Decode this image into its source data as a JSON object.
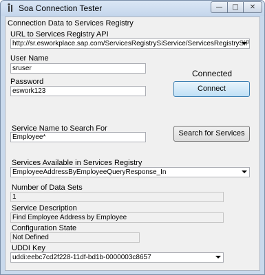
{
  "window": {
    "title": "Soa Connection Tester",
    "controls": {
      "minimize": "—",
      "maximize": "□",
      "close": "✕"
    }
  },
  "connection": {
    "group_label": "Connection Data to Services Registry",
    "url_label": "URL to Services Registry API",
    "url_value": "http://sr.esworkplace.sap.com/ServicesRegistrySiService/ServicesRegistrySiPort",
    "user_label": "User Name",
    "user_value": "sruser",
    "password_label": "Password",
    "password_value": "eswork123",
    "status": "Connected",
    "connect_button": "Connect"
  },
  "search": {
    "label": "Service Name to Search For",
    "value": "Employee*",
    "button": "Search for Services"
  },
  "services": {
    "available_label": "Services Available in Services Registry",
    "selected": "EmployeeAddressByEmployeeQueryResponse_In",
    "datasets_label": "Number of Data Sets",
    "datasets_value": "1",
    "description_label": "Service Description",
    "description_value": "Find Employee Address by Employee",
    "config_label": "Configuration State",
    "config_value": "Not Defined",
    "uddi_label": "UDDI Key",
    "uddi_value": "uddi:eebc7cd2f228-11df-bd1b-0000003c8657"
  }
}
